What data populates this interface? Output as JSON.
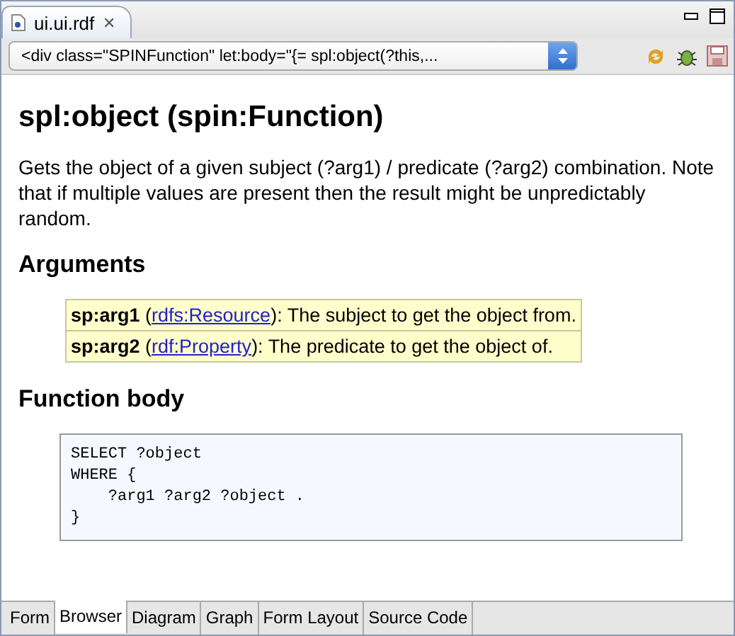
{
  "editor_tab": {
    "title": "ui.ui.rdf",
    "close": "✕"
  },
  "toolbar": {
    "selector_value": "<div class=\"SPINFunction\" let:body=\"{= spl:object(?this,..."
  },
  "page": {
    "title": "spl:object (spin:Function)",
    "description": "Gets the object of a given subject (?arg1) / predicate (?arg2) combination. Note that if multiple values are present then the result might be unpredictably random.",
    "arguments_heading": "Arguments",
    "arguments": [
      {
        "name": "sp:arg1",
        "open": " (",
        "type": "rdfs:Resource",
        "rest": "): The subject to get the object from."
      },
      {
        "name": "sp:arg2",
        "open": " (",
        "type": "rdf:Property",
        "rest": "): The predicate to get the object of."
      }
    ],
    "body_heading": "Function body",
    "code": "SELECT ?object\nWHERE {\n    ?arg1 ?arg2 ?object .\n}"
  },
  "bottom_tabs": [
    {
      "label": "Form",
      "selected": false
    },
    {
      "label": "Browser",
      "selected": true
    },
    {
      "label": "Diagram",
      "selected": false
    },
    {
      "label": "Graph",
      "selected": false
    },
    {
      "label": "Form Layout",
      "selected": false
    },
    {
      "label": "Source Code",
      "selected": false
    }
  ]
}
